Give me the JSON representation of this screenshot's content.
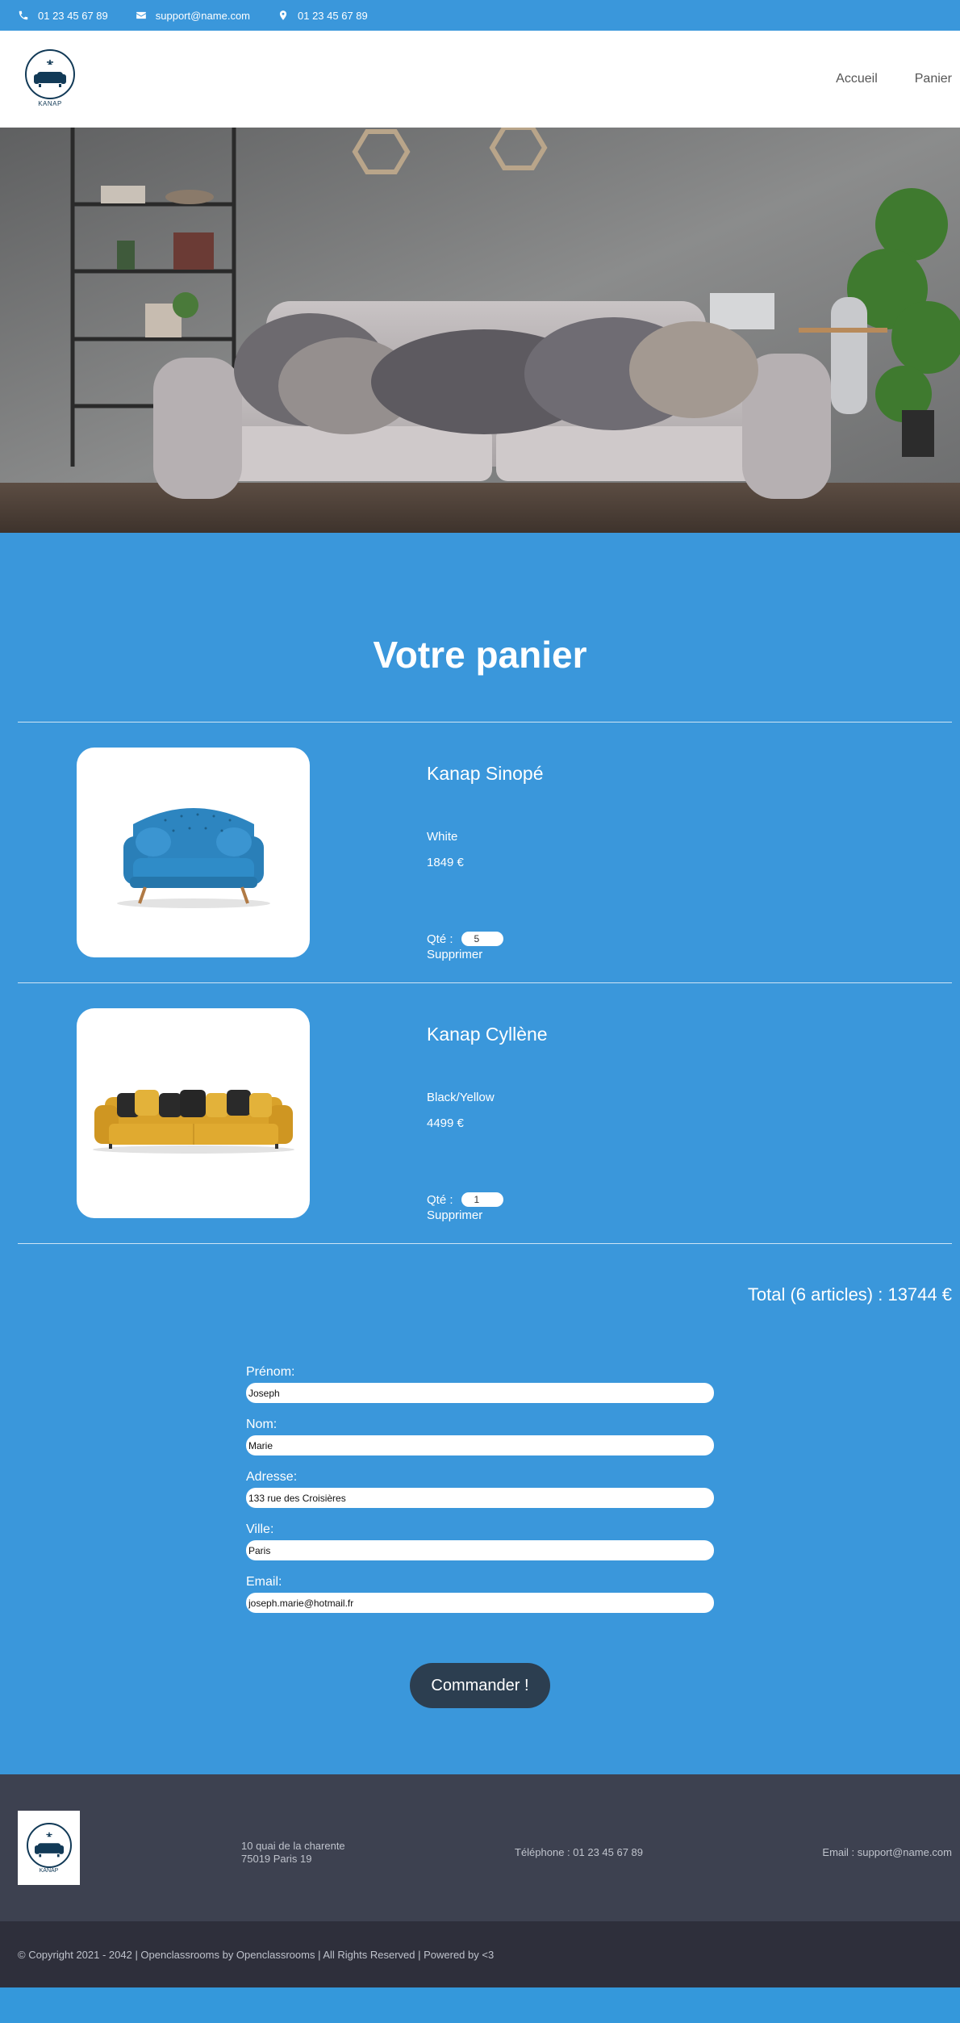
{
  "topbar": {
    "phone": "01 23 45 67 89",
    "email": "support@name.com",
    "location": "01 23 45 67 89"
  },
  "header": {
    "logo_text": "KANAP",
    "nav": [
      "Accueil",
      "Panier"
    ]
  },
  "main": {
    "title": "Votre panier",
    "items": [
      {
        "name": "Kanap Sinopé",
        "color": "White",
        "price": "1849 €",
        "qty_label": "Qté :",
        "qty": "5",
        "delete_label": "Supprimer"
      },
      {
        "name": "Kanap Cyllène",
        "color": "Black/Yellow",
        "price": "4499 €",
        "qty_label": "Qté :",
        "qty": "1",
        "delete_label": "Supprimer"
      }
    ],
    "total": "Total (6 articles) : 13744 €"
  },
  "form": {
    "fields": [
      {
        "label": "Prénom:",
        "value": "Joseph"
      },
      {
        "label": "Nom:",
        "value": "Marie"
      },
      {
        "label": "Adresse:",
        "value": "133 rue des Croisières"
      },
      {
        "label": "Ville:",
        "value": "Paris"
      },
      {
        "label": "Email:",
        "value": "joseph.marie@hotmail.fr"
      }
    ],
    "submit_label": "Commander !"
  },
  "footer": {
    "logo_text": "KANAP",
    "address_line1": "10 quai de la charente",
    "address_line2": "75019 Paris 19",
    "phone": "Téléphone : 01 23 45 67 89",
    "email": "Email : support@name.com",
    "copyright": "© Copyright 2021 - 2042 | Openclassrooms by Openclassrooms | All Rights Reserved | Powered by <3"
  },
  "colors": {
    "primary": "#3a97db",
    "header_bg": "#ffffff",
    "footer_bg": "#3d4150",
    "footer_bottom_bg": "#2e2f3b",
    "button_bg": "#2c3e50",
    "logo": "#123a57"
  }
}
